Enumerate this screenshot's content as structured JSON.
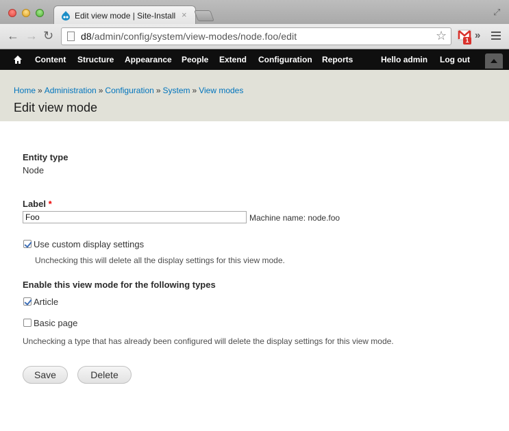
{
  "browser": {
    "tab_title": "Edit view mode | Site-Install",
    "tab_close": "×",
    "url_host": "d8",
    "url_path": "/admin/config/system/view-modes/node.foo/edit",
    "gmail_count": "1",
    "extensions_chevron": "»"
  },
  "admin_toolbar": {
    "items": [
      "Content",
      "Structure",
      "Appearance",
      "People",
      "Extend",
      "Configuration",
      "Reports"
    ],
    "hello_prefix": "Hello",
    "user": "admin",
    "logout": "Log out"
  },
  "breadcrumb": [
    "Home",
    "Administration",
    "Configuration",
    "System",
    "View modes"
  ],
  "breadcrumb_separator": "»",
  "page_title": "Edit view mode",
  "form": {
    "entity_type_label": "Entity type",
    "entity_type_value": "Node",
    "label_label": "Label",
    "required_marker": "*",
    "label_value": "Foo",
    "machine_name": "Machine name: node.foo",
    "custom_display_label": "Use custom display settings",
    "custom_display_checked": true,
    "custom_display_desc": "Unchecking this will delete all the display settings for this view mode.",
    "types_heading": "Enable this view mode for the following types",
    "types": [
      {
        "label": "Article",
        "checked": true
      },
      {
        "label": "Basic page",
        "checked": false
      }
    ],
    "types_desc": "Unchecking a type that has already been configured will delete the display settings for this view mode.",
    "save_label": "Save",
    "delete_label": "Delete"
  },
  "colors": {
    "admin_bar": "#0f0f0f",
    "header_bg": "#e1e1d8",
    "link": "#0074bd",
    "required": "#ee0000"
  }
}
